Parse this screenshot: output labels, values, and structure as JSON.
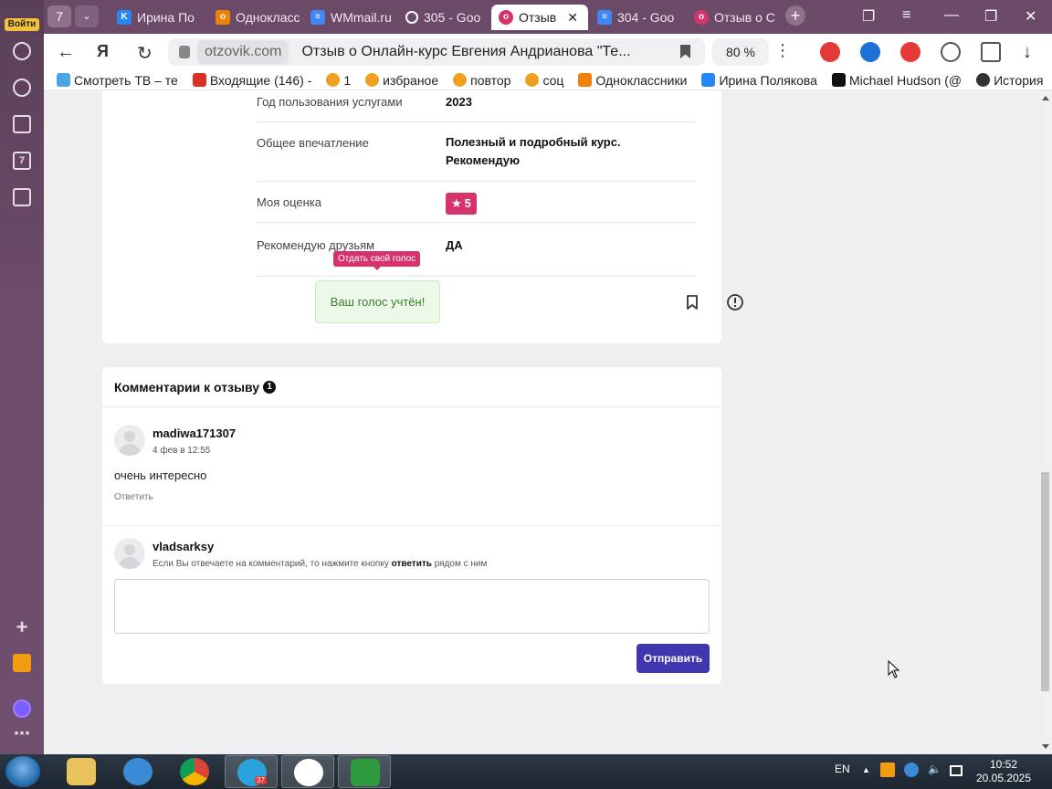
{
  "sidebar": {
    "login_label": "Войти"
  },
  "tabs": {
    "counter": "7",
    "items": [
      {
        "label": "Ирина По",
        "color": "#2787f5",
        "icon": "vk-icon"
      },
      {
        "label": "Однокласс",
        "color": "#ee8208",
        "icon": "odnoklassniki-icon"
      },
      {
        "label": "WMmail.ru",
        "color": "#4285f4",
        "icon": "docs-icon"
      },
      {
        "label": "305 - Goo",
        "color": "#ffffff",
        "icon": "loading-icon"
      },
      {
        "label": "Отзыв",
        "color": "#d6336c",
        "icon": "otzovik-icon",
        "active": true
      },
      {
        "label": "304 - Goo",
        "color": "#4285f4",
        "icon": "docs-icon"
      },
      {
        "label": "Отзыв о С",
        "color": "#d6336c",
        "icon": "otzovik-icon"
      }
    ]
  },
  "addressbar": {
    "domain": "otzovik.com",
    "title": "Отзыв о Онлайн-курс Евгения Андрианова \"Те...",
    "zoom": "80 %"
  },
  "bookmarks": [
    {
      "label": "Смотреть ТВ – те",
      "color": "#4aa6e8"
    },
    {
      "label": "Входящие (146) -",
      "color": "#d93025"
    },
    {
      "label": "1",
      "color": "#f0a020"
    },
    {
      "label": "избраное",
      "color": "#f0a020"
    },
    {
      "label": "повтор",
      "color": "#f0a020"
    },
    {
      "label": "соц",
      "color": "#f0a020"
    },
    {
      "label": "Одноклассники",
      "color": "#ee8208"
    },
    {
      "label": "Ирина Полякова",
      "color": "#2787f5"
    },
    {
      "label": "Michael Hudson (@",
      "color": "#111111"
    },
    {
      "label": "История",
      "color": "#333333"
    }
  ],
  "review": {
    "rows": [
      {
        "label": "Год пользования услугами",
        "value": "2023"
      },
      {
        "label": "Общее впечатление",
        "value": "Полезный и подробный курс. Рекомендую"
      },
      {
        "label": "Моя оценка",
        "value": "5"
      },
      {
        "label": "Рекомендую друзьям",
        "value": "ДА"
      }
    ],
    "tooltip": "Отдать свой голос",
    "vote_status": "Ваш голос учтён!"
  },
  "comments": {
    "title": "Комментарии к отзыву",
    "count": "1",
    "items": [
      {
        "user": "madiwa171307",
        "date": "4 фев в 12:55",
        "text": "очень интересно",
        "reply_label": "Ответить"
      }
    ],
    "compose": {
      "user": "vladsarksy",
      "hint_before": "Если Вы отвечаете на комментарий, то нажмите кнопку",
      "hint_bold": "ответить",
      "hint_after": "рядом с ним",
      "textarea_value": "",
      "submit_label": "Отправить"
    }
  },
  "taskbar": {
    "lang": "EN",
    "time": "10:52",
    "date": "20.05.2025",
    "telegram_badge": "37"
  },
  "colors": {
    "accent": "#d6336c",
    "primary_button": "#3f37b0",
    "success": "#2e9b3e"
  }
}
